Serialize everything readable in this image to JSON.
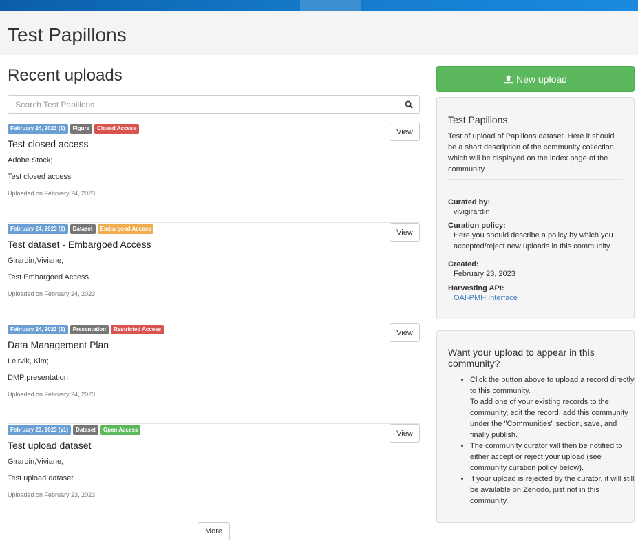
{
  "page": {
    "title": "Test Papillons"
  },
  "main": {
    "heading": "Recent uploads",
    "search_placeholder": "Search Test Papillons",
    "view_label": "View",
    "more_label": "More"
  },
  "records": [
    {
      "date": "February 24, 2023 (1)",
      "type": "Figure",
      "access": "Closed Access",
      "title": "Test closed access",
      "creators": "Adobe Stock;",
      "description": "Test closed access",
      "uploaded": "Uploaded on February 24, 2023"
    },
    {
      "date": "February 24, 2023 (1)",
      "type": "Dataset",
      "access": "Embargoed Access",
      "title": "Test dataset - Embargoed Access",
      "creators": "Girardin,Viviane;",
      "description": "Test Embargoed Access",
      "uploaded": "Uploaded on February 24, 2023"
    },
    {
      "date": "February 24, 2023 (1)",
      "type": "Presentation",
      "access": "Restricted Access",
      "title": "Data Management Plan",
      "creators": "Leirvik, Kim;",
      "description": "DMP presentation",
      "uploaded": "Uploaded on February 24, 2023"
    },
    {
      "date": "February 23, 2023 (v1)",
      "type": "Dataset",
      "access": "Open Access",
      "title": "Test upload dataset",
      "creators": "Girardin,Viviane;",
      "description": "Test upload dataset",
      "uploaded": "Uploaded on February 23, 2023"
    }
  ],
  "colors": {
    "closed": "#d9534f",
    "embargoed": "#f0ad4e",
    "restricted": "#d9534f",
    "open": "#5cb85c",
    "date": "#6a9fd4",
    "type": "#777777"
  },
  "sidebar": {
    "new_upload_label": "New upload",
    "community": {
      "name": "Test Papillons",
      "description": "Test of upload of Papillons dataset. Here it should be a  short description of the community collection, which will be displayed on the index page of the community.",
      "curated_by_label": "Curated by:",
      "curated_by": "vivigirardin",
      "policy_label": "Curation policy:",
      "policy": "Here you should describe a policy by which you accepted/reject new uploads in this community.",
      "created_label": "Created:",
      "created": "February 23, 2023",
      "harvesting_label": "Harvesting API:",
      "harvesting_link": "OAI-PMH Interface"
    },
    "info": {
      "heading": "Want your upload to appear in this community?",
      "items": [
        "Click the button above to upload a record directly to this community.",
        "To add one of your existing records to the community, edit the record, add this community under the \"Communities\" section, save, and finally publish.",
        "The community curator will then be notified to either accept or reject your upload (see community curation policy below).",
        "If your upload is rejected by the curator, it will still be available on Zenodo, just not in this community."
      ]
    }
  }
}
